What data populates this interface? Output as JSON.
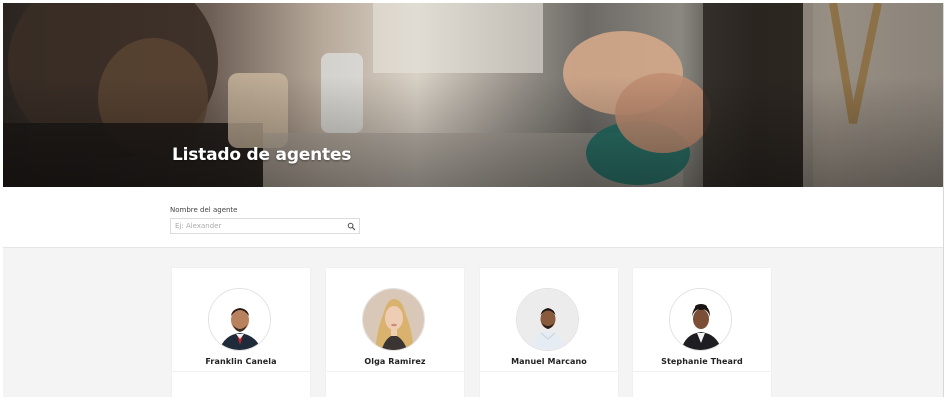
{
  "hero": {
    "title": "Listado de agentes"
  },
  "search": {
    "label": "Nombre del agente",
    "placeholder": "Ej: Alexander",
    "value": ""
  },
  "agents": [
    {
      "name": "Franklin Canela"
    },
    {
      "name": "Olga Ramirez"
    },
    {
      "name": "Manuel Marcano"
    },
    {
      "name": "Stephanie Theard"
    }
  ],
  "colors": {
    "hero_dark": "#2a2420",
    "section_bg": "#f4f4f4",
    "card_bg": "#ffffff",
    "text_dark": "#222222"
  }
}
